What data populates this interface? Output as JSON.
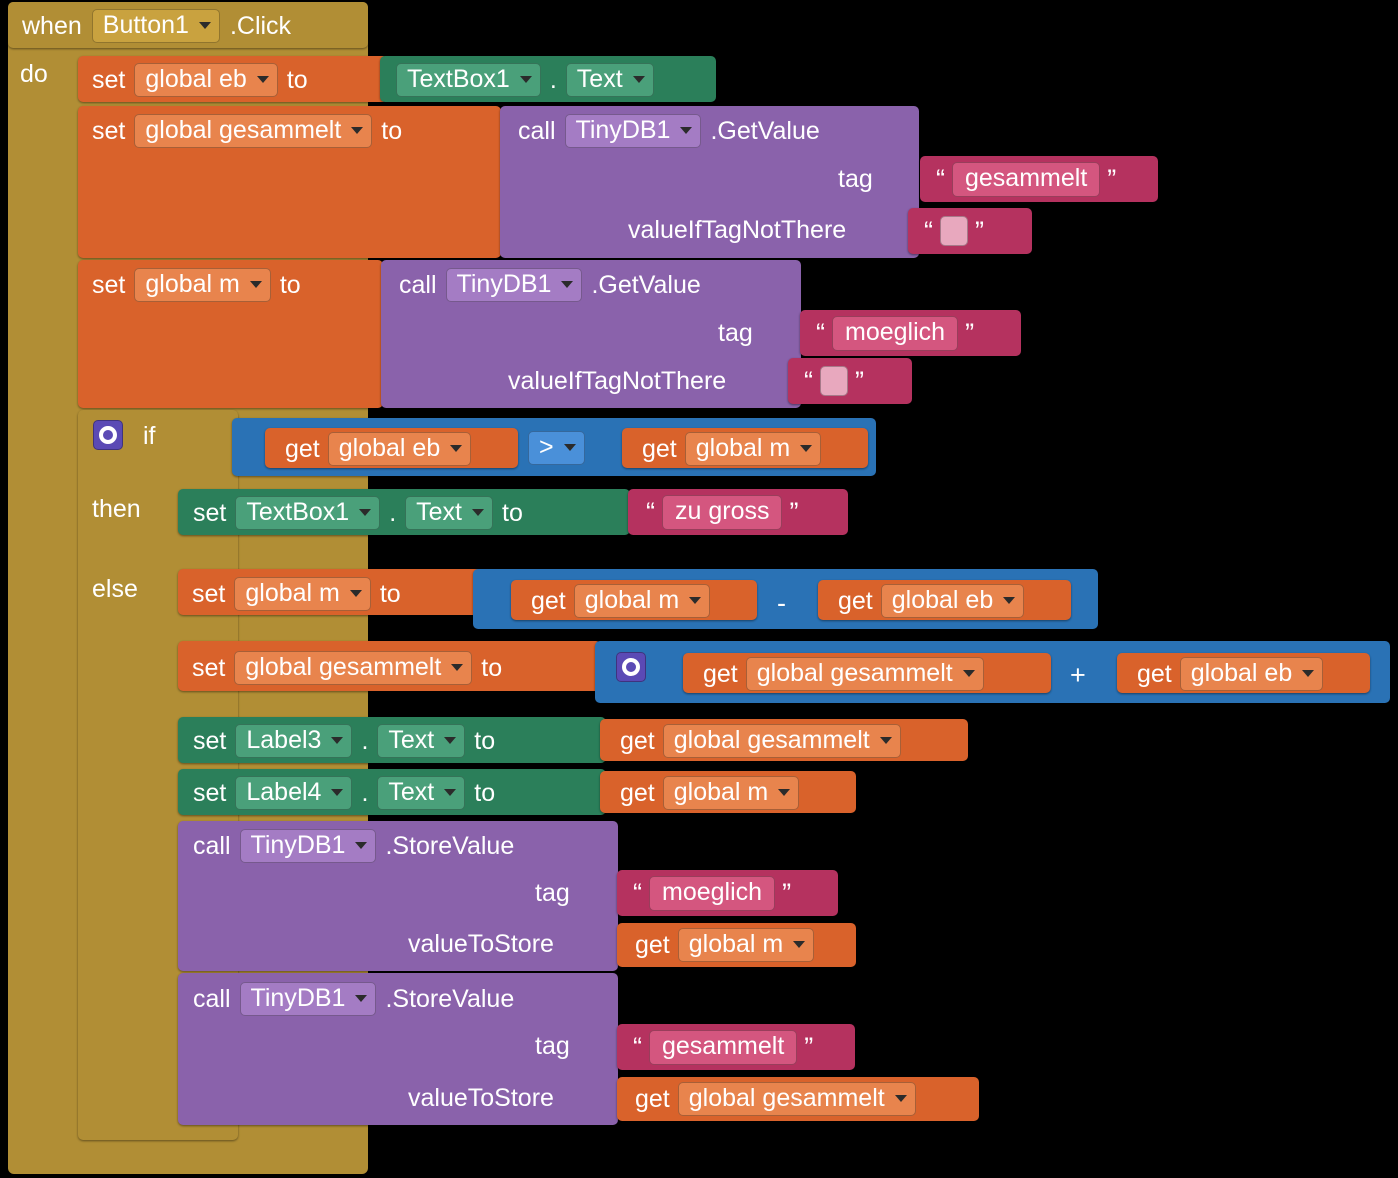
{
  "title": "App Inventor blocks - Button1.Click",
  "event": {
    "when_label": "when",
    "component": "Button1",
    "event_name": ".Click",
    "do_label": "do"
  },
  "blocks": {
    "set_label": "set",
    "to_label": "to",
    "get_label": "get",
    "call_label": "call",
    "if_label": "if",
    "then_label": "then",
    "else_label": "else",
    "dot": ".",
    "tag_label": "tag",
    "value_if_tag_not_there_label": "valueIfTagNotThere",
    "value_to_store_label": "valueToStore",
    "getvalue_label": ".GetValue",
    "storevalue_label": ".StoreValue"
  },
  "statements": {
    "s1": {
      "var": "global eb",
      "src_component": "TextBox1",
      "src_property": "Text"
    },
    "s2": {
      "var": "global gesammelt",
      "component": "TinyDB1",
      "method": ".GetValue",
      "tag_value": "gesammelt",
      "fallback_value": ""
    },
    "s3": {
      "var": "global m",
      "component": "TinyDB1",
      "method": ".GetValue",
      "tag_value": "moeglich",
      "fallback_value": ""
    },
    "s4_if": {
      "left": "global eb",
      "operator": ">",
      "right": "global m"
    },
    "s5_then": {
      "component": "TextBox1",
      "property": "Text",
      "text_value": "zu gross"
    },
    "s6": {
      "var": "global m",
      "left": "global m",
      "operator": "-",
      "right": "global eb"
    },
    "s7": {
      "var": "global gesammelt",
      "left": "global gesammelt",
      "operator": "+",
      "right": "global eb"
    },
    "s8": {
      "component": "Label3",
      "property": "Text",
      "value_var": "global gesammelt"
    },
    "s9": {
      "component": "Label4",
      "property": "Text",
      "value_var": "global m"
    },
    "s10": {
      "component": "TinyDB1",
      "method": ".StoreValue",
      "tag_value": "moeglich",
      "store_var": "global m"
    },
    "s11": {
      "component": "TinyDB1",
      "method": ".StoreValue",
      "tag_value": "gesammelt",
      "store_var": "global gesammelt"
    }
  },
  "colors": {
    "event": "#b18e35",
    "variable": "#d9622b",
    "component": "#2b7f5a",
    "call": "#8a62ab",
    "text": "#b5325f",
    "logic": "#2a72b5",
    "gear": "#5b4ab5"
  }
}
